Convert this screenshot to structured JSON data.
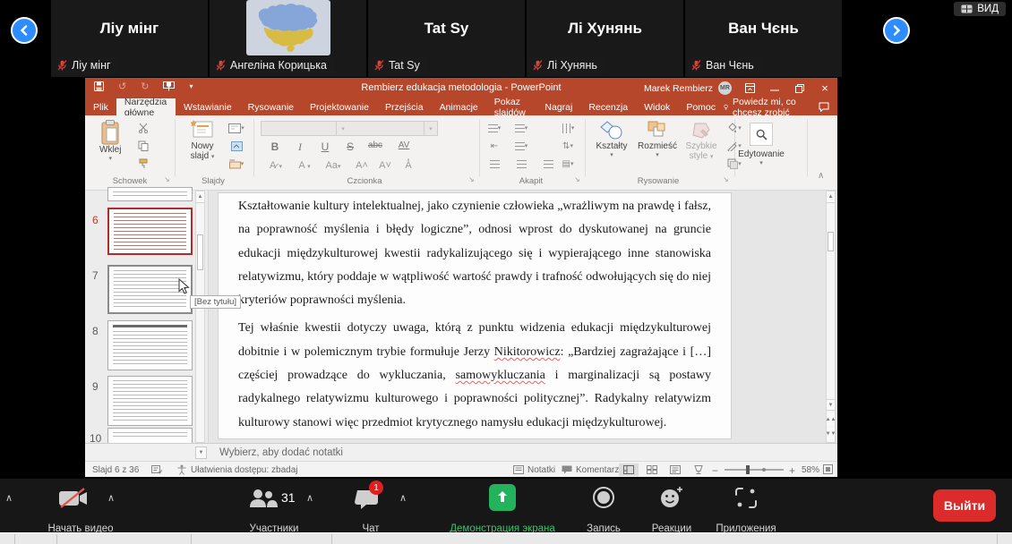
{
  "zoom_ui": {
    "view_button_label": "ВИД",
    "participants_strip": [
      {
        "display_name": "Ліу мінг",
        "nameplate": "Ліу мінг"
      },
      {
        "display_name": "",
        "nameplate": "Ангеліна Корицька"
      },
      {
        "display_name": "Tat Sy",
        "nameplate": "Tat Sy"
      },
      {
        "display_name": "Лі Хунянь",
        "nameplate": "Лі Хунянь"
      },
      {
        "display_name": "Ван Чєнь",
        "nameplate": "Ван Чєнь"
      }
    ],
    "toolbar": {
      "video_label": "Начать видео",
      "participants_label": "Участники",
      "participants_count": "31",
      "chat_label": "Чат",
      "chat_badge": "1",
      "share_label": "Демонстрация экрана",
      "record_label": "Запись",
      "reactions_label": "Реакции",
      "apps_label": "Приложения",
      "leave_label": "Выйти"
    }
  },
  "powerpoint": {
    "title": "Rembierz edukacja metodologia - PowerPoint",
    "user_name": "Marek Rembierz",
    "user_initials": "MR",
    "tabs": [
      "Plik",
      "Narzędzia główne",
      "Wstawianie",
      "Rysowanie",
      "Projektowanie",
      "Przejścia",
      "Animacje",
      "Pokaz slajdów",
      "Nagraj",
      "Recenzja",
      "Widok",
      "Pomoc"
    ],
    "active_tab": "Narzędzia główne",
    "tell_me": "Powiedz mi, co chcesz zrobić",
    "ribbon": {
      "paste": "Wklej",
      "new_slide": "Nowy slajd",
      "shapes": "Kształty",
      "arrange": "Rozmieść",
      "quick_styles_1": "Szybkie",
      "quick_styles_2": "style",
      "editing": "Edytowanie",
      "font_buttons": [
        "B",
        "I",
        "U",
        "S",
        "abc",
        "AV"
      ],
      "groups": {
        "clipboard": "Schowek",
        "slides": "Slajdy",
        "font": "Czcionka",
        "paragraph": "Akapit",
        "drawing": "Rysowanie"
      }
    },
    "thumbnails": {
      "numbers": [
        "6",
        "7",
        "8",
        "9",
        "10"
      ],
      "selected_number": "6",
      "tooltip": "[Bez tytułu]"
    },
    "slide": {
      "p1": "Kształtowanie kultury intelektualnej, jako czynienie człowieka „wrażliwym na prawdę i fałsz, na poprawność myślenia i błędy logiczne”, odnosi wprost do dyskutowanej na gruncie edukacji międzykulturowej kwestii radykalizującego się i wypierającego inne stanowiska relatywizmu, który poddaje w wątpliwość wartość prawdy i trafność odwołujących się do niej kryteriów poprawności myślenia.",
      "p2_a": "Tej właśnie kwestii dotyczy uwaga, którą z punktu widzenia edukacji międzykulturowej dobitnie i w polemicznym trybie formułuje Jerzy ",
      "p2_misspell1": "Nikitorowicz",
      "p2_b": ": „Bardziej zagrażające i […] częściej prowadzące do wykluczania, ",
      "p2_misspell2": "samowykluczania",
      "p2_c": " i marginalizacji są postawy radykalnego relatywizmu kulturowego i poprawności politycznej”. Radykalny relatywizm kulturowy stanowi więc przedmiot krytycznego namysłu edukacji międzykulturowej."
    },
    "notes_placeholder": "Wybierz, aby dodać notatki",
    "status": {
      "slide_counter": "Slajd 6 z 36",
      "accessibility": "Ułatwienia dostępu: zbadaj",
      "notes": "Notatki",
      "comments": "Komentarze",
      "zoom_level": "58%"
    }
  },
  "colors": {
    "ppt_red": "#B7472A",
    "zoom_blue": "#2D8CFF",
    "share_green": "#23B35D",
    "leave_red": "#DC2B2B",
    "badge_red": "#E02020",
    "muted_mic_red": "#D84A3F"
  }
}
